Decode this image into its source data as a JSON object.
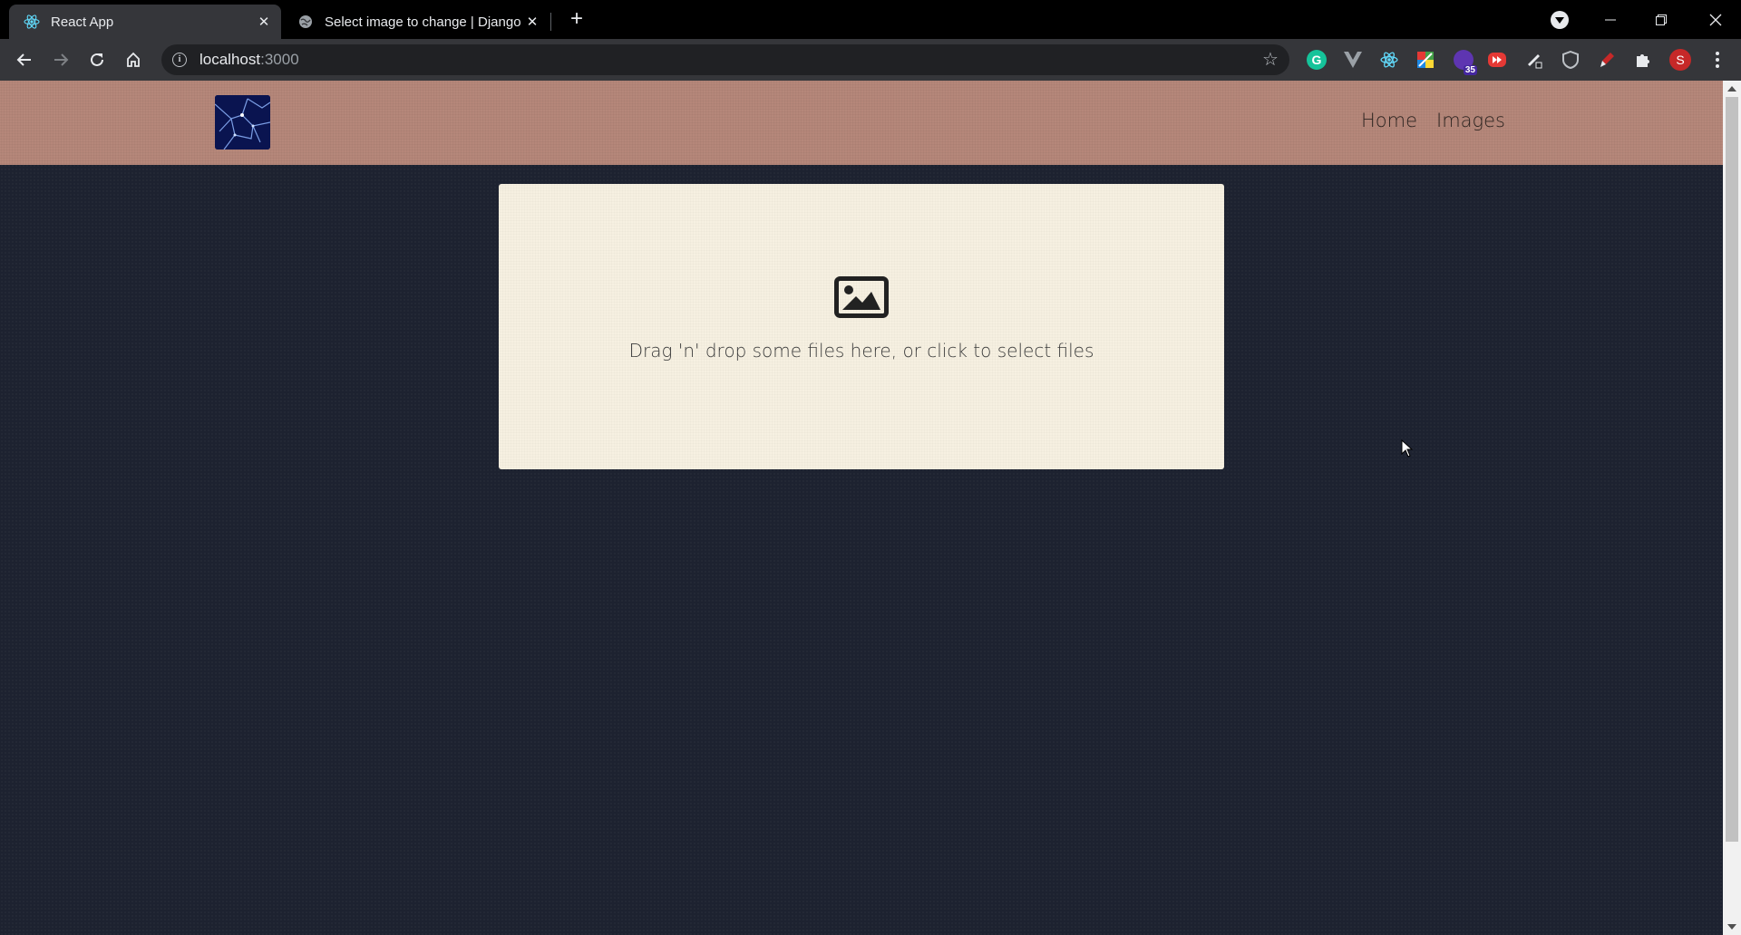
{
  "browser": {
    "tabs": [
      {
        "title": "React App",
        "icon": "react-icon",
        "active": true
      },
      {
        "title": "Select image to change | Django",
        "icon": "globe-icon",
        "active": false
      }
    ],
    "url_host": "localhost",
    "url_port": ":3000",
    "extensions": [
      "grammarly-icon",
      "vue-devtools-icon",
      "react-devtools-icon",
      "color-picker-icon",
      "extension-badge-icon",
      "youtube-icon",
      "pen-icon",
      "shield-icon",
      "brush-icon",
      "puzzle-icon"
    ],
    "extension_badge": "35",
    "profile_initial": "S"
  },
  "nav": {
    "links": [
      "Home",
      "Images"
    ]
  },
  "dropzone": {
    "icon": "image-icon",
    "text": "Drag 'n' drop some files here, or click to select files"
  }
}
